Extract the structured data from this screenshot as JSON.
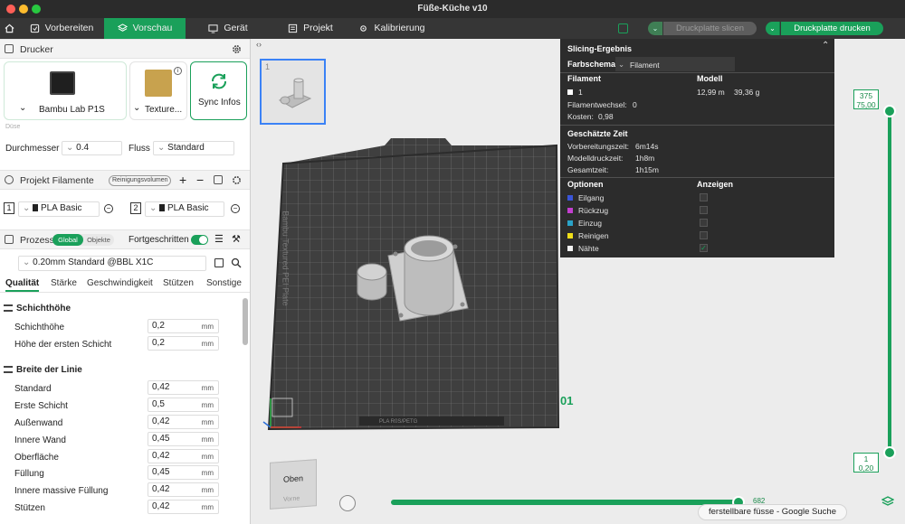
{
  "window": {
    "title": "Füße-Küche v10"
  },
  "toolbar": {
    "home_icon": "home-icon",
    "tabs": [
      {
        "label": "Vorbereiten",
        "icon": "prepare-icon"
      },
      {
        "label": "Vorschau",
        "icon": "preview-icon"
      },
      {
        "label": "Gerät",
        "icon": "device-icon"
      },
      {
        "label": "Projekt",
        "icon": "project-icon"
      },
      {
        "label": "Kalibrierung",
        "icon": "calibration-icon"
      }
    ],
    "slice_button": "Druckplatte slicen",
    "print_button": "Druckplatte drucken",
    "accent": "#1aa05a"
  },
  "printer": {
    "section_title": "Drucker",
    "printer_name": "Bambu Lab P1S",
    "plate_name": "Texture...",
    "sync_label": "Sync Infos",
    "nozzle_caption": "Düse",
    "diameter_label": "Durchmesser",
    "diameter_value": "0.4",
    "flow_label": "Fluss",
    "flow_value": "Standard"
  },
  "filament": {
    "section_title": "Projekt Filamente",
    "purge_button": "Reinigungsvolumen",
    "slots": [
      {
        "num": "1",
        "name": "PLA Basic"
      },
      {
        "num": "2",
        "name": "PLA Basic"
      }
    ]
  },
  "process": {
    "section_title": "Prozess",
    "toggle_global": "Global",
    "toggle_objects": "Objekte",
    "advanced_label": "Fortgeschritten",
    "profile": "0.20mm Standard @BBL X1C",
    "tabs": [
      "Qualität",
      "Stärke",
      "Geschwindigkeit",
      "Stützen",
      "Sonstige"
    ],
    "groups": [
      {
        "title": "Schichthöhe",
        "rows": [
          {
            "label": "Schichthöhe",
            "value": "0,2",
            "unit": "mm"
          },
          {
            "label": "Höhe der ersten Schicht",
            "value": "0,2",
            "unit": "mm"
          }
        ]
      },
      {
        "title": "Breite der Linie",
        "rows": [
          {
            "label": "Standard",
            "value": "0,42",
            "unit": "mm"
          },
          {
            "label": "Erste Schicht",
            "value": "0,5",
            "unit": "mm"
          },
          {
            "label": "Außenwand",
            "value": "0,42",
            "unit": "mm"
          },
          {
            "label": "Innere Wand",
            "value": "0,45",
            "unit": "mm"
          },
          {
            "label": "Oberfläche",
            "value": "0,42",
            "unit": "mm"
          },
          {
            "label": "Füllung",
            "value": "0,45",
            "unit": "mm"
          },
          {
            "label": "Innere massive Füllung",
            "value": "0,42",
            "unit": "mm"
          },
          {
            "label": "Stützen",
            "value": "0,42",
            "unit": "mm"
          }
        ]
      }
    ]
  },
  "viewport": {
    "thumbnail_index": "1",
    "plate_label": "Bambu Textured PEI Plate",
    "plate_bottom_label": "PLA R0S/PETG",
    "plate_number": "01",
    "view_cube_front": "Oben",
    "view_cube_bottom": "Vorne"
  },
  "slicing_result": {
    "title": "Slicing-Ergebnis",
    "color_scheme_label": "Farbschema",
    "color_scheme_value": "Filament",
    "col_filament": "Filament",
    "col_model": "Modell",
    "row_index": "1",
    "length": "12,99 m",
    "weight": "39,36 g",
    "filament_changes_label": "Filamentwechsel:",
    "filament_changes_value": "0",
    "cost_label": "Kosten:",
    "cost_value": "0,98",
    "time_title": "Geschätzte Zeit",
    "prep_label": "Vorbereitungszeit:",
    "prep_value": "6m14s",
    "model_label": "Modelldruckzeit:",
    "model_value": "1h8m",
    "total_label": "Gesamtzeit:",
    "total_value": "1h15m",
    "options_label": "Optionen",
    "show_label": "Anzeigen",
    "options": [
      {
        "name": "Eilgang",
        "color": "#3a55d9",
        "checked": false
      },
      {
        "name": "Rückzug",
        "color": "#c23fcf",
        "checked": false
      },
      {
        "name": "Einzug",
        "color": "#2aa3c8",
        "checked": false
      },
      {
        "name": "Reinigen",
        "color": "#f0de19",
        "checked": false
      },
      {
        "name": "Nähte",
        "color": "#f2f2f2",
        "checked": true
      }
    ]
  },
  "layer_slider": {
    "top_layer": "375",
    "top_height": "75,00",
    "bottom_layer": "1",
    "bottom_height": "0,20"
  },
  "move_slider": {
    "value": "682"
  },
  "search_chip": "ferstellbare füsse - Google Suche"
}
